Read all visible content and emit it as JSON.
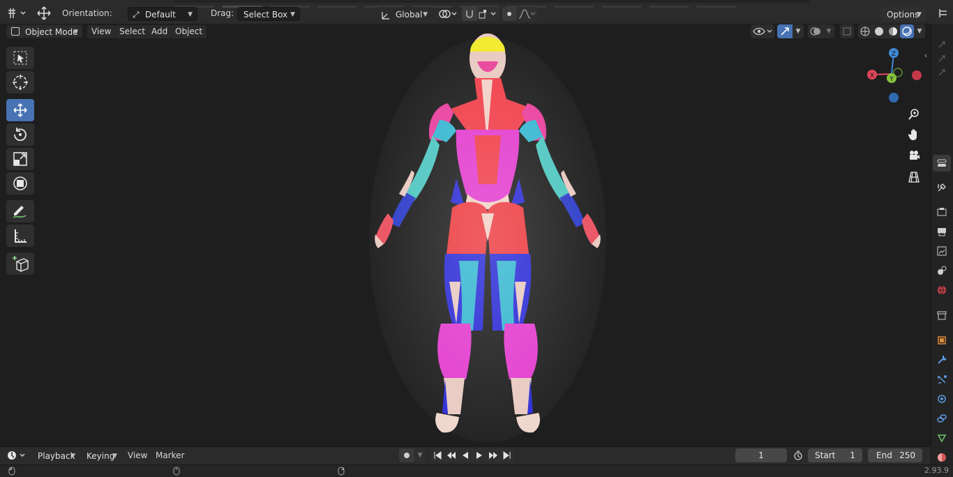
{
  "header": {
    "orientation_label": "Orientation:",
    "orientation_value": "Default",
    "drag_label": "Drag:",
    "drag_value": "Select Box",
    "transform_space": "Global",
    "options_label": "Options"
  },
  "viewport_header": {
    "mode": "Object Mode",
    "menus": [
      "View",
      "Select",
      "Add",
      "Object"
    ]
  },
  "toolbar": {
    "tools": [
      "select-box-tool",
      "cursor-tool",
      "move-tool",
      "rotate-tool",
      "scale-tool",
      "transform-tool",
      "annotate-tool",
      "measure-tool",
      "add-cube-tool"
    ],
    "active_tool": "move-tool"
  },
  "gizmo": {
    "axes": {
      "z": "Z",
      "x": "X",
      "y": "Y"
    }
  },
  "timeline": {
    "menus": [
      "Playback",
      "Keying",
      "View",
      "Marker"
    ],
    "current_frame": "1",
    "start_label": "Start",
    "start_value": "1",
    "end_label": "End",
    "end_value": "250"
  },
  "status": {
    "version": "2.93.9"
  },
  "colors": {
    "accent": "#4772b3",
    "axis_x": "#e0465a",
    "axis_y": "#86c43c",
    "axis_z": "#3f8ad6",
    "background": "#1e1e1e"
  }
}
